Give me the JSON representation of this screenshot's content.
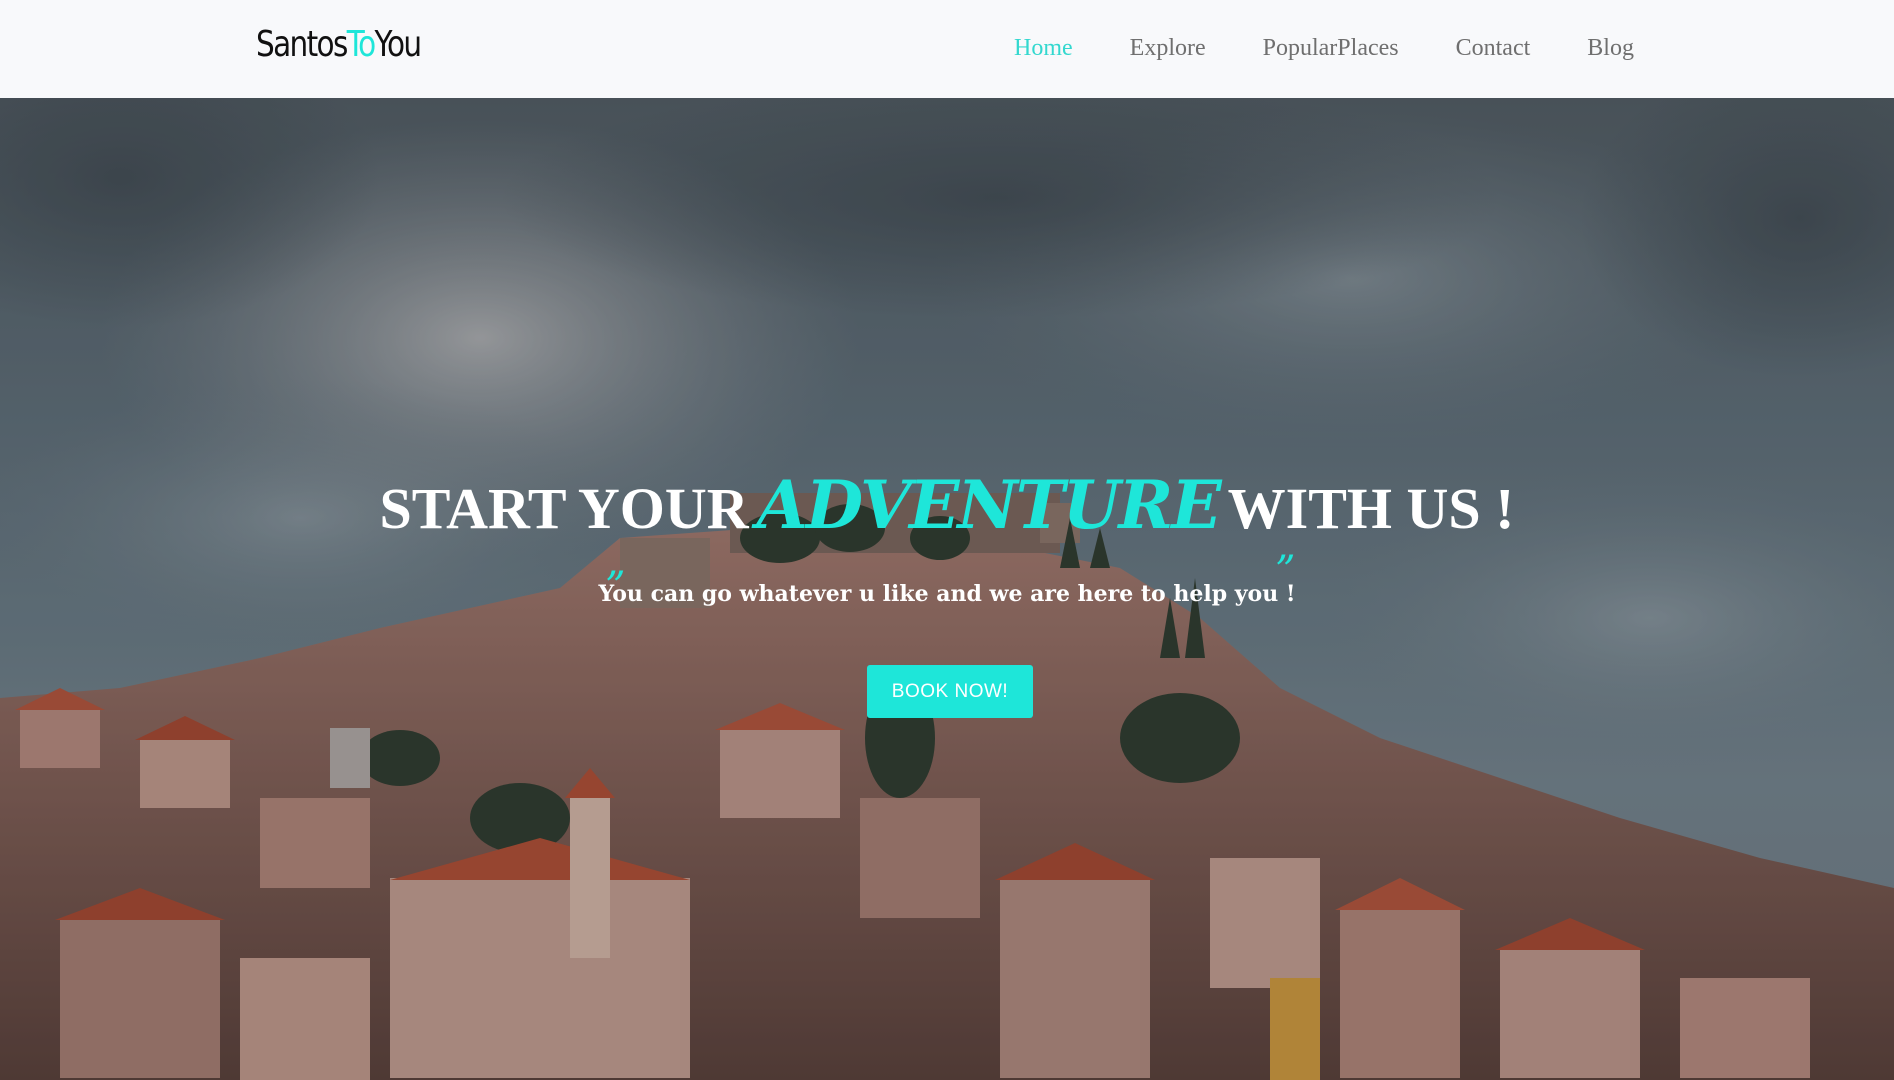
{
  "brand": {
    "logo_part1": "Santos",
    "logo_accent": "To",
    "logo_part2": "You",
    "accent_color": "#1ee6d9"
  },
  "nav": {
    "items": [
      {
        "label": "Home",
        "active": true
      },
      {
        "label": "Explore",
        "active": false
      },
      {
        "label": "PopularPlaces",
        "active": false
      },
      {
        "label": "Contact",
        "active": false
      },
      {
        "label": "Blog",
        "active": false
      }
    ]
  },
  "hero": {
    "headline_start": "START YOUR",
    "headline_accent": "ADVENTURE",
    "headline_end": "WITH US !",
    "subtitle": "You can go whatever u like and we are here to help you !",
    "open_quote": "”",
    "close_quote": "”",
    "cta_label": "BOOK NOW!",
    "background": "hillside-town-photo"
  }
}
